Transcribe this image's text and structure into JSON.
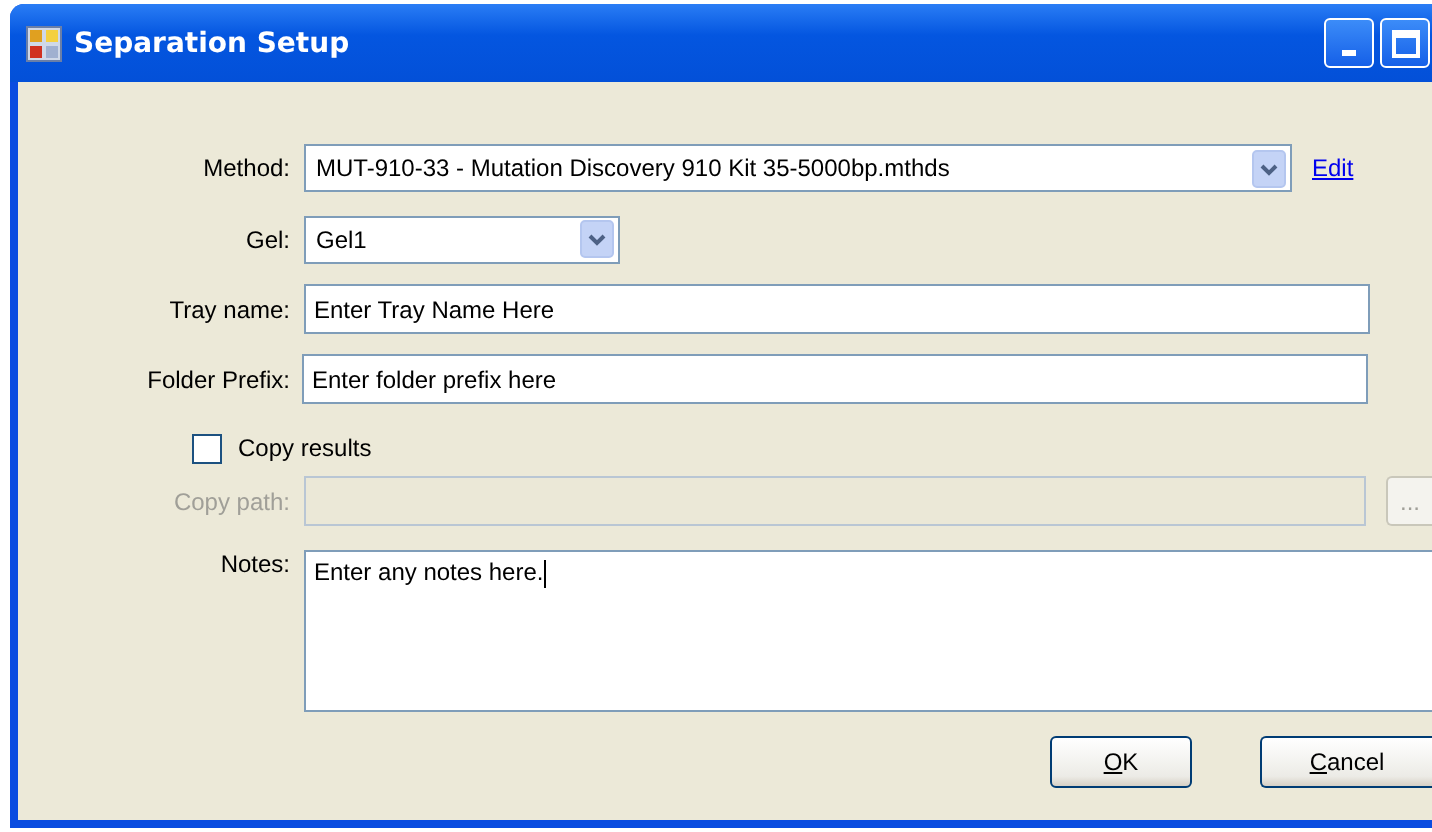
{
  "window": {
    "title": "Separation Setup",
    "buttons": [
      {
        "kind": "minimize"
      },
      {
        "kind": "maximize"
      }
    ]
  },
  "method": {
    "label": "Method:",
    "value": "MUT-910-33 - Mutation Discovery 910 Kit 35-5000bp.mthds",
    "link": "Edit"
  },
  "gel": {
    "label": "Gel:",
    "value": "Gel1"
  },
  "tray_name": {
    "label": "Tray name:",
    "value": "Enter Tray Name Here"
  },
  "folder_prefix": {
    "label": "Folder Prefix:",
    "value": "Enter folder prefix here"
  },
  "copy_results": {
    "label": "Copy results",
    "checked": false
  },
  "copy_path": {
    "label": "Copy path:",
    "disabled": true,
    "browse": "..."
  },
  "notes": {
    "label": "Notes:",
    "value": "Enter any notes here."
  },
  "buttons": [
    {
      "underlined": "O",
      "rest": "K"
    },
    {
      "underlined": "C",
      "rest": "ancel"
    }
  ]
}
